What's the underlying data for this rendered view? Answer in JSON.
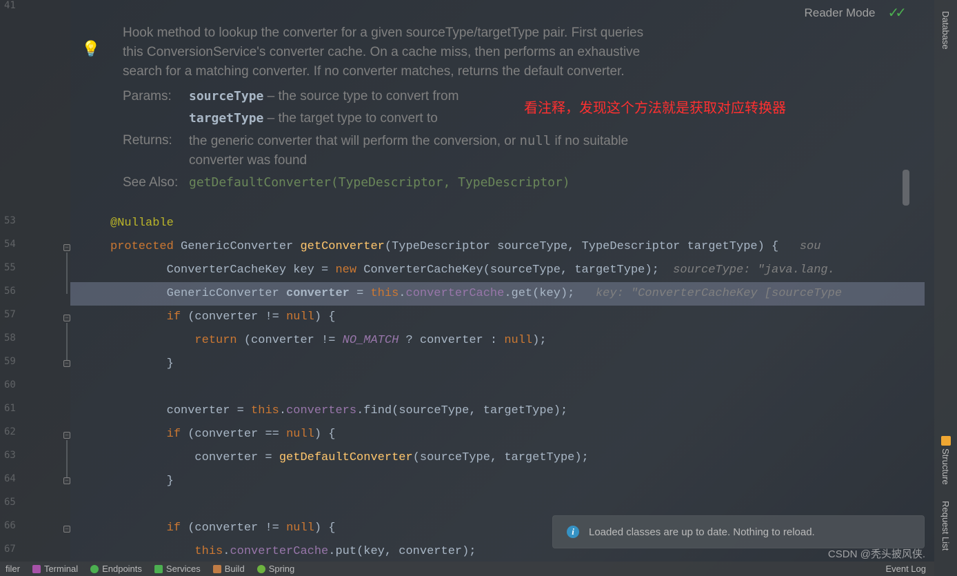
{
  "header": {
    "reader_mode": "Reader Mode"
  },
  "sidebar_right": {
    "database_label": "Database",
    "structure_label": "Structure",
    "request_list_label": "Request List"
  },
  "annotation_chinese": "看注释，发现这个方法就是获取对应转换器",
  "javadoc": {
    "desc": "Hook method to lookup the converter for a given sourceType/targetType pair. First queries this ConversionService's converter cache. On a cache miss, then performs an exhaustive search for a matching converter. If no converter matches, returns the default converter.",
    "params_tag": "Params:",
    "param1_name": "sourceType",
    "param1_desc": " – the source type to convert from",
    "param2_name": "targetType",
    "param2_desc": " – the target type to convert to",
    "returns_tag": "Returns:",
    "returns_pre": "the generic converter that will perform the conversion, or ",
    "returns_code": "null",
    "returns_post": " if no suitable converter was found",
    "seealso_tag": "See Also:",
    "seealso_link": "getDefaultConverter(TypeDescriptor, TypeDescriptor)"
  },
  "line_numbers": [
    "41",
    "53",
    "54",
    "55",
    "56",
    "57",
    "58",
    "59",
    "60",
    "61",
    "62",
    "63",
    "64",
    "65",
    "66",
    "67"
  ],
  "code": {
    "l53_ann": "@Nullable",
    "l54_kw_protected": "protected",
    "l54_type1": "GenericConverter",
    "l54_method": "getConverter",
    "l54_paren_open": "(",
    "l54_ptype1": "TypeDescriptor",
    "l54_pname1": "sourceType",
    "l54_comma": ", ",
    "l54_ptype2": "TypeDescriptor",
    "l54_pname2": "targetType",
    "l54_close": ") {",
    "l54_hint": "   sou",
    "l55_pre": "        ConverterCacheKey key = ",
    "l55_new": "new",
    "l55_ctor": " ConverterCacheKey(",
    "l55_p1": "sourceType",
    "l55_sep": ", ",
    "l55_p2": "targetType",
    "l55_end": ");",
    "l55_hint": "  sourceType: \"java.lang.",
    "l56_pre": "        GenericConverter ",
    "l56_var": "converter",
    "l56_mid": " = ",
    "l56_this": "this",
    "l56_dot": ".",
    "l56_field": "converterCache",
    "l56_call": ".get(key);",
    "l56_hint": "   key: \"ConverterCacheKey [sourceType",
    "l57_if": "if",
    "l57_pre": "        ",
    "l57_cond": " (converter != ",
    "l57_null": "null",
    "l57_end": ") {",
    "l58_pre": "            ",
    "l58_ret": "return",
    "l58_mid": " (converter != ",
    "l58_const": "NO_MATCH",
    "l58_rest": " ? converter : ",
    "l58_null": "null",
    "l58_end": ");",
    "l59": "        }",
    "l61_pre": "        converter = ",
    "l61_this": "this",
    "l61_dot": ".",
    "l61_field": "converters",
    "l61_call": ".find(",
    "l61_p1": "sourceType",
    "l61_sep": ", ",
    "l61_p2": "targetType",
    "l61_end": ");",
    "l62_pre": "        ",
    "l62_if": "if",
    "l62_cond": " (converter == ",
    "l62_null": "null",
    "l62_end": ") {",
    "l63_pre": "            converter = ",
    "l63_call": "getDefaultConverter",
    "l63_open": "(",
    "l63_p1": "sourceType",
    "l63_sep": ", ",
    "l63_p2": "targetType",
    "l63_end": ");",
    "l64": "        }",
    "l66_pre": "        ",
    "l66_if": "if",
    "l66_cond": " (converter != ",
    "l66_null": "null",
    "l66_end": ") {",
    "l67_pre": "            ",
    "l67_this": "this",
    "l67_dot": ".",
    "l67_field": "converterCache",
    "l67_call": ".put(key, converter);"
  },
  "notification": "Loaded classes are up to date. Nothing to reload.",
  "bottom_tools": {
    "profiler": "filer",
    "terminal": "Terminal",
    "endpoints": "Endpoints",
    "services": "Services",
    "build": "Build",
    "spring": "Spring",
    "event_log": "Event Log"
  },
  "watermark": "CSDN @秃头披风侠."
}
